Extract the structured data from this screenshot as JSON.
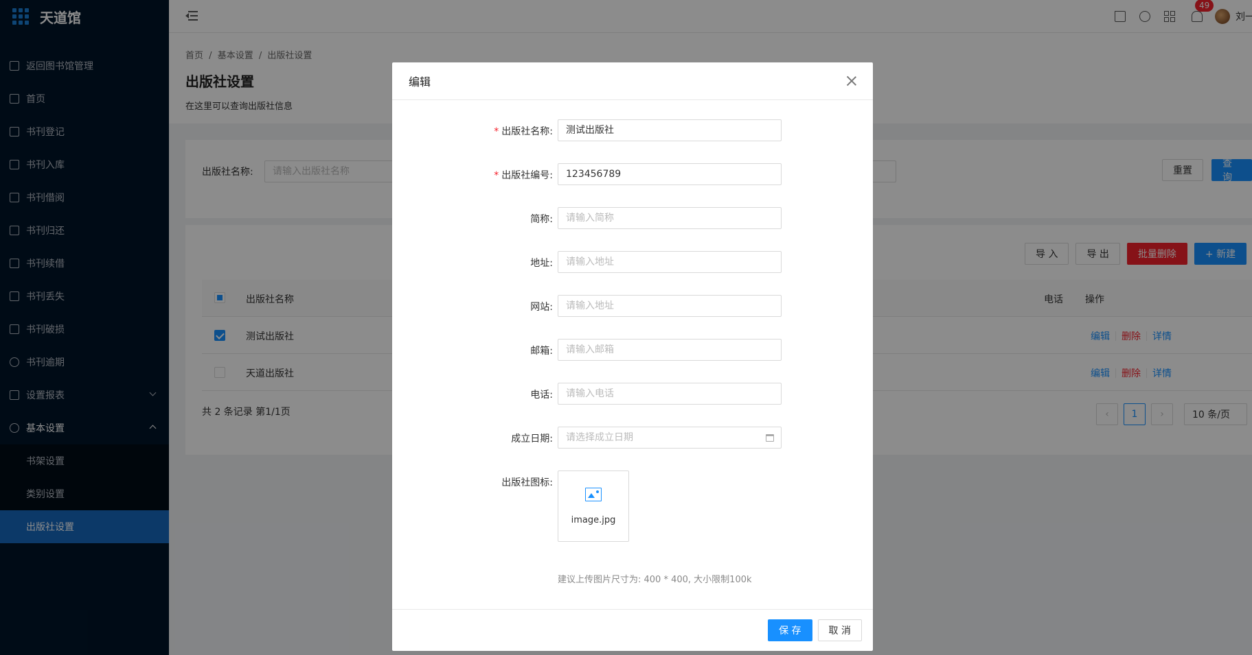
{
  "app": {
    "name": "天道馆"
  },
  "sidebar": {
    "items": [
      {
        "label": "返回图书馆管理",
        "icon": "return-icon"
      },
      {
        "label": "首页",
        "icon": "home-icon"
      },
      {
        "label": "书刊登记",
        "icon": "pen-icon"
      },
      {
        "label": "书刊入库",
        "icon": "login-icon"
      },
      {
        "label": "书刊借阅",
        "icon": "book-icon"
      },
      {
        "label": "书刊归还",
        "icon": "book-icon"
      },
      {
        "label": "书刊续借",
        "icon": "book-icon"
      },
      {
        "label": "书刊丢失",
        "icon": "book-icon"
      },
      {
        "label": "书刊破损",
        "icon": "book-icon"
      },
      {
        "label": "书刊逾期",
        "icon": "info-icon"
      },
      {
        "label": "设置报表",
        "icon": "report-icon"
      },
      {
        "label": "基本设置",
        "icon": "gear-icon"
      }
    ],
    "sub_items": [
      {
        "label": "书架设置"
      },
      {
        "label": "类别设置"
      },
      {
        "label": "出版社设置"
      }
    ]
  },
  "header": {
    "notification_count": "49",
    "user_name": "刘一"
  },
  "page": {
    "breadcrumb": [
      "首页",
      "/",
      "基本设置",
      "/",
      "出版社设置"
    ],
    "title": "出版社设置",
    "description": "在这里可以查询出版社信息"
  },
  "search": {
    "label": "出版社名称:",
    "placeholder": "请输入出版社名称",
    "reset_label": "重置",
    "query_label": "查询"
  },
  "toolbar": {
    "import_label": "导 入",
    "export_label": "导 出",
    "batch_delete_label": "批量删除",
    "new_label": "+ 新建"
  },
  "table": {
    "columns": {
      "name": "出版社名称",
      "phone": "电话",
      "actions": "操作"
    },
    "rows": [
      {
        "name": "测试出版社",
        "checked": true
      },
      {
        "name": "天道出版社",
        "checked": false
      }
    ],
    "actions": {
      "edit": "编辑",
      "delete": "删除",
      "detail": "详情"
    },
    "summary": "共 2 条记录 第1/1页",
    "current_page": "1",
    "page_size": "10 条/页"
  },
  "modal": {
    "title": "编辑",
    "fields": {
      "name": {
        "label": "出版社名称:",
        "value": "测试出版社",
        "required": true
      },
      "code": {
        "label": "出版社编号:",
        "value": "123456789",
        "required": true
      },
      "short": {
        "label": "简称:",
        "placeholder": "请输入简称"
      },
      "address": {
        "label": "地址:",
        "placeholder": "请输入地址"
      },
      "website": {
        "label": "网站:",
        "placeholder": "请输入地址"
      },
      "email": {
        "label": "邮箱:",
        "placeholder": "请输入邮箱"
      },
      "phone": {
        "label": "电话:",
        "placeholder": "请输入电话"
      },
      "founded": {
        "label": "成立日期:",
        "placeholder": "请选择成立日期"
      },
      "logo": {
        "label": "出版社图标:",
        "file_name": "image.jpg"
      }
    },
    "hint": "建议上传图片尺寸为: 400 * 400, 大小限制100k",
    "save_label": "保 存",
    "cancel_label": "取 消"
  }
}
